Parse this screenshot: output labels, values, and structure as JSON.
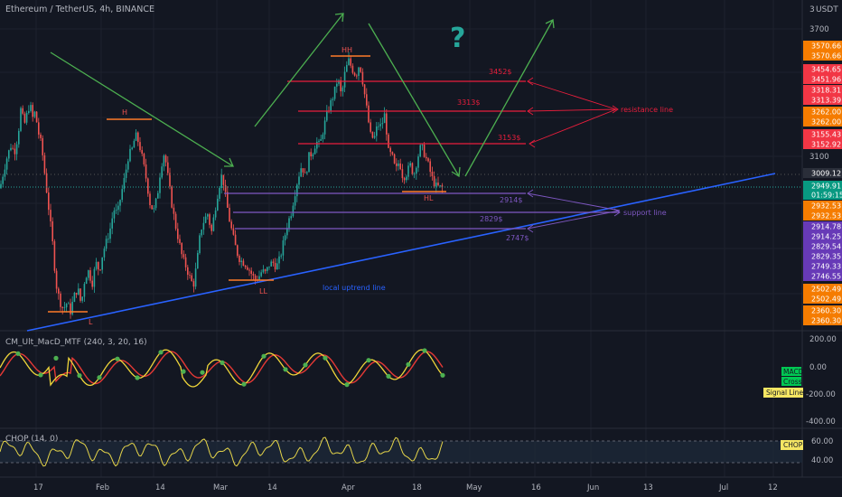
{
  "header": {
    "title": "Ethereum / TetherUS, 4h, BINANCE",
    "currency": "USDT",
    "scale_badge": "3"
  },
  "colors": {
    "background": "#131722",
    "grid": "#1e222d",
    "text": "#b2b5be",
    "candle_up": "#26a69a",
    "candle_down": "#ef5350",
    "resistance": "#e91e3c",
    "support": "#7e57c2",
    "uptrend": "#2962ff",
    "arrow": "#4caf50",
    "question": "#26a69a",
    "level_marker": "#ff7b29",
    "macd": "#f0d63a",
    "signal": "#e53935",
    "cross": "#4caf50",
    "chop": "#e5d54a"
  },
  "chart_data": [
    {
      "type": "candlestick",
      "title": "Ethereum / TetherUS, 4h, BINANCE",
      "x_ticks": [
        "17",
        "Feb",
        "14",
        "Mar",
        "14",
        "Apr",
        "18",
        "May",
        "16",
        "Jun",
        "13",
        "Jul",
        "12"
      ],
      "y_ticks": [
        3700.0,
        3100.0
      ],
      "price_path": [
        [
          0,
          2950
        ],
        [
          4,
          3030
        ],
        [
          8,
          3100
        ],
        [
          12,
          3150
        ],
        [
          16,
          3120
        ],
        [
          20,
          3200
        ],
        [
          23,
          3320
        ],
        [
          27,
          3250
        ],
        [
          30,
          3300
        ],
        [
          33,
          3350
        ],
        [
          36,
          3280
        ],
        [
          39,
          3310
        ],
        [
          42,
          3220
        ],
        [
          46,
          3150
        ],
        [
          50,
          3000
        ],
        [
          54,
          2850
        ],
        [
          58,
          2700
        ],
        [
          62,
          2500
        ],
        [
          66,
          2420
        ],
        [
          70,
          2380
        ],
        [
          74,
          2410
        ],
        [
          78,
          2370
        ],
        [
          82,
          2440
        ],
        [
          86,
          2480
        ],
        [
          90,
          2400
        ],
        [
          94,
          2530
        ],
        [
          98,
          2560
        ],
        [
          102,
          2500
        ],
        [
          106,
          2600
        ],
        [
          110,
          2560
        ],
        [
          114,
          2650
        ],
        [
          118,
          2700
        ],
        [
          122,
          2760
        ],
        [
          126,
          2850
        ],
        [
          130,
          2830
        ],
        [
          134,
          2920
        ],
        [
          138,
          3000
        ],
        [
          142,
          3100
        ],
        [
          146,
          3130
        ],
        [
          150,
          3200
        ],
        [
          154,
          3160
        ],
        [
          158,
          3080
        ],
        [
          162,
          2990
        ],
        [
          166,
          2880
        ],
        [
          170,
          2840
        ],
        [
          174,
          2910
        ],
        [
          178,
          3050
        ],
        [
          182,
          3120
        ],
        [
          186,
          3000
        ],
        [
          190,
          2880
        ],
        [
          194,
          2780
        ],
        [
          198,
          2700
        ],
        [
          202,
          2620
        ],
        [
          206,
          2580
        ],
        [
          210,
          2530
        ],
        [
          214,
          2490
        ],
        [
          218,
          2600
        ],
        [
          222,
          2750
        ],
        [
          226,
          2800
        ],
        [
          230,
          2830
        ],
        [
          234,
          2740
        ],
        [
          238,
          2850
        ],
        [
          242,
          2950
        ],
        [
          246,
          3020
        ],
        [
          250,
          2900
        ],
        [
          254,
          2800
        ],
        [
          258,
          2720
        ],
        [
          262,
          2650
        ],
        [
          266,
          2610
        ],
        [
          270,
          2600
        ],
        [
          274,
          2580
        ],
        [
          278,
          2550
        ],
        [
          282,
          2520
        ],
        [
          286,
          2530
        ],
        [
          290,
          2560
        ],
        [
          294,
          2550
        ],
        [
          298,
          2590
        ],
        [
          302,
          2600
        ],
        [
          306,
          2580
        ],
        [
          310,
          2620
        ],
        [
          314,
          2700
        ],
        [
          318,
          2780
        ],
        [
          322,
          2830
        ],
        [
          326,
          2920
        ],
        [
          330,
          3000
        ],
        [
          334,
          3060
        ],
        [
          338,
          3000
        ],
        [
          342,
          3100
        ],
        [
          346,
          3120
        ],
        [
          350,
          3170
        ],
        [
          354,
          3150
        ],
        [
          358,
          3230
        ],
        [
          362,
          3300
        ],
        [
          366,
          3350
        ],
        [
          370,
          3400
        ],
        [
          374,
          3470
        ],
        [
          378,
          3380
        ],
        [
          382,
          3500
        ],
        [
          386,
          3550
        ],
        [
          390,
          3510
        ],
        [
          394,
          3480
        ],
        [
          398,
          3540
        ],
        [
          402,
          3440
        ],
        [
          406,
          3320
        ],
        [
          410,
          3200
        ],
        [
          414,
          3180
        ],
        [
          418,
          3250
        ],
        [
          422,
          3240
        ],
        [
          426,
          3300
        ],
        [
          430,
          3120
        ],
        [
          434,
          3100
        ],
        [
          438,
          3030
        ],
        [
          442,
          3080
        ],
        [
          446,
          3000
        ],
        [
          450,
          3020
        ],
        [
          454,
          3060
        ],
        [
          458,
          3010
        ],
        [
          462,
          3090
        ],
        [
          466,
          3150
        ],
        [
          470,
          3110
        ],
        [
          474,
          3060
        ],
        [
          478,
          3000
        ],
        [
          482,
          2960
        ],
        [
          486,
          2955
        ],
        [
          490,
          2950
        ]
      ],
      "annotations": {
        "swing_labels": [
          "HH",
          "H",
          "L",
          "LL",
          "HL"
        ],
        "resistance_levels": [
          "3452$",
          "3313$",
          "3153$"
        ],
        "support_levels": [
          "2914$",
          "2829$",
          "2747$"
        ],
        "notes": [
          "resistance line",
          "support line",
          "local uptrend line"
        ],
        "question_mark": "?"
      },
      "price_labels": [
        {
          "value": "3570.66",
          "kind": "orange"
        },
        {
          "value": "3570.66",
          "kind": "orange"
        },
        {
          "value": "3454.65",
          "kind": "red"
        },
        {
          "value": "3451.96",
          "kind": "red"
        },
        {
          "value": "3318.31",
          "kind": "red"
        },
        {
          "value": "3313.39",
          "kind": "red"
        },
        {
          "value": "3262.00",
          "kind": "orange"
        },
        {
          "value": "3262.00",
          "kind": "orange"
        },
        {
          "value": "3155.43",
          "kind": "red"
        },
        {
          "value": "3152.92",
          "kind": "red"
        },
        {
          "value": "3009.12",
          "kind": "dark"
        },
        {
          "value": "2949.91",
          "kind": "teal"
        },
        {
          "value": "01:59:15",
          "kind": "teal"
        },
        {
          "value": "2932.53",
          "kind": "orange"
        },
        {
          "value": "2932.53",
          "kind": "orange"
        },
        {
          "value": "2914.78",
          "kind": "purple"
        },
        {
          "value": "2914.25",
          "kind": "purple"
        },
        {
          "value": "2829.54",
          "kind": "purple"
        },
        {
          "value": "2829.35",
          "kind": "purple"
        },
        {
          "value": "2749.33",
          "kind": "purple"
        },
        {
          "value": "2746.55",
          "kind": "purple"
        },
        {
          "value": "2502.49",
          "kind": "orange"
        },
        {
          "value": "2502.49",
          "kind": "orange"
        },
        {
          "value": "2360.30",
          "kind": "orange"
        },
        {
          "value": "2360.30",
          "kind": "orange"
        }
      ]
    },
    {
      "type": "line",
      "title": "CM_Ult_MacD_MTF (240, 3, 20, 16)",
      "y_ticks": [
        "200.00",
        "0.00",
        "-200.00",
        "-400.00"
      ],
      "legend": [
        "MACD",
        "Cross",
        "Signal Line"
      ]
    },
    {
      "type": "line",
      "title": "CHOP (14, 0)",
      "y_ticks": [
        "60.00",
        "40.00"
      ],
      "legend": [
        "CHOP"
      ]
    }
  ]
}
